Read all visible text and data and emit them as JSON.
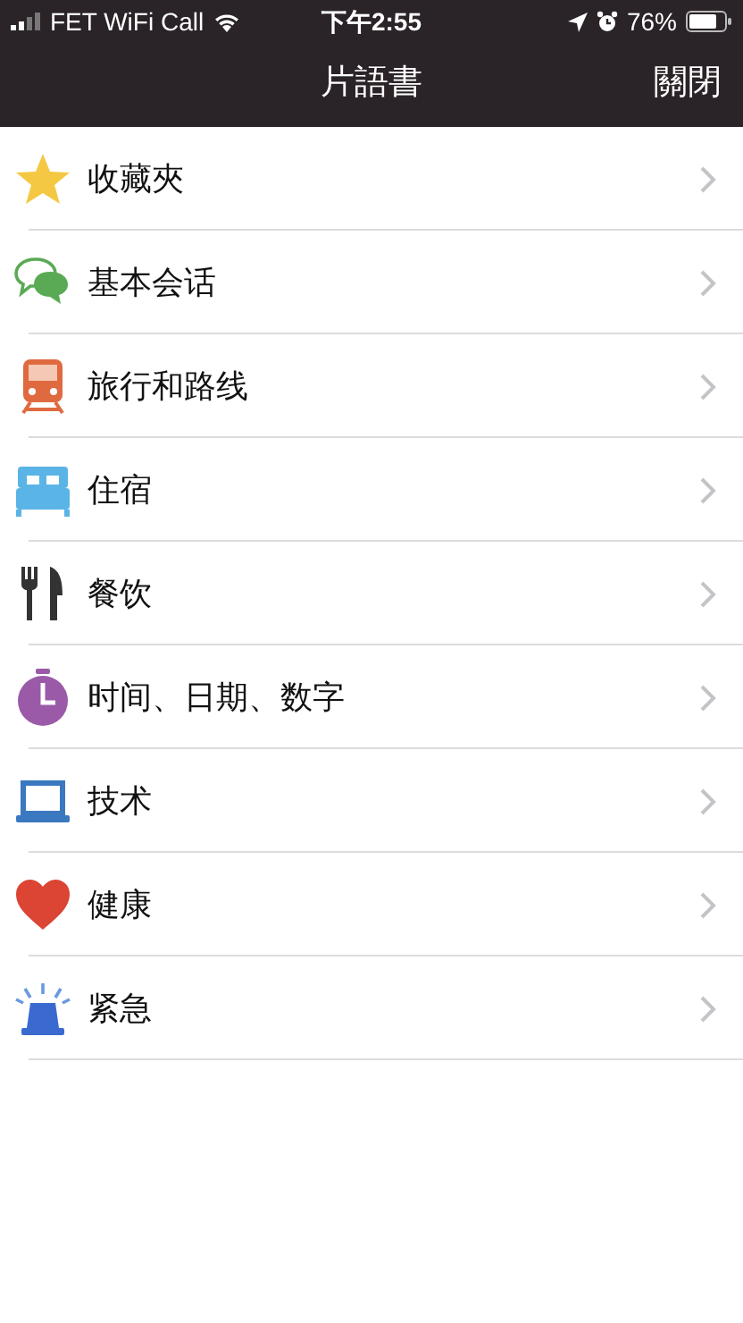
{
  "status_bar": {
    "carrier": "FET WiFi Call",
    "time": "下午2:55",
    "battery": "76%"
  },
  "nav_bar": {
    "title": "片語書",
    "close": "關閉"
  },
  "categories": [
    {
      "label": "收藏夾"
    },
    {
      "label": "基本会话"
    },
    {
      "label": "旅行和路线"
    },
    {
      "label": "住宿"
    },
    {
      "label": "餐饮"
    },
    {
      "label": "时间、日期、数字"
    },
    {
      "label": "技术"
    },
    {
      "label": "健康"
    },
    {
      "label": "紧急"
    }
  ]
}
